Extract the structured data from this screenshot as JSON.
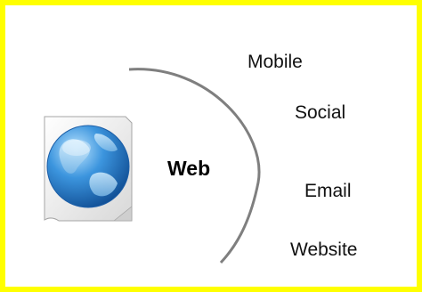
{
  "diagram": {
    "center_label": "Web",
    "outer_items": [
      {
        "label": "Mobile"
      },
      {
        "label": "Social"
      },
      {
        "label": "Email"
      },
      {
        "label": "Website"
      }
    ],
    "icon": "globe-document-icon"
  },
  "colors": {
    "frame_border": "#ffff00",
    "arc_stroke": "#7f7f7f",
    "globe_blue": "#2b7fd0",
    "text": "#111111"
  }
}
